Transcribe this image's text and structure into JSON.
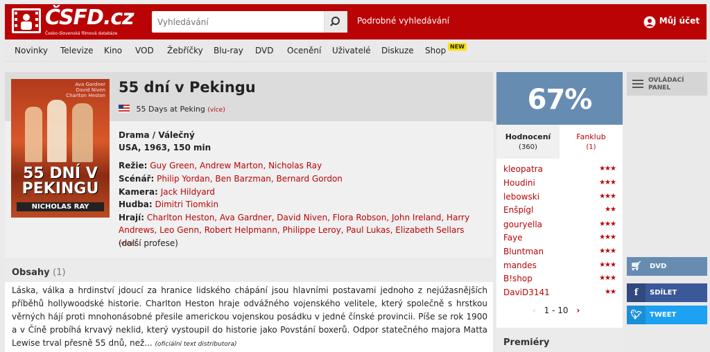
{
  "header": {
    "logo_text": "ČSFD.cz",
    "logo_sub": "Česko-Slovenská filmová databáze",
    "search_placeholder": "Vyhledávání",
    "advanced_search": "Podrobné vyhledávání",
    "account": "Můj účet"
  },
  "nav": {
    "items": [
      "Novinky",
      "Televize",
      "Kino",
      "VOD",
      "Žebříčky",
      "Blu-ray",
      "DVD",
      "Ocenění",
      "Uživatelé",
      "Diskuze",
      "Shop"
    ],
    "new_badge": "NEW"
  },
  "film": {
    "poster_title": "55 DNÍ V PEKINGU",
    "poster_names": [
      "Ava Gardner",
      "David Niven",
      "Charlton Heston"
    ],
    "poster_director": "NICHOLAS RAY",
    "title": "55 dní v Pekingu",
    "original_title": "55 Days at Peking",
    "more": "(více)",
    "genre": "Drama / Válečný",
    "origin": "USA, 1963, 150 min",
    "director_label": "Režie:",
    "directors": "Guy Green, Andrew Marton, Nicholas Ray",
    "writer_label": "Scénář:",
    "writers": "Philip Yordan, Ben Barzman, Bernard Gordon",
    "camera_label": "Kamera:",
    "camera": "Jack Hildyard",
    "music_label": "Hudba:",
    "music": "Dimitri Tiomkin",
    "cast_label": "Hrají:",
    "cast": "Charlton Heston, Ava Gardner, David Niven, Flora Robson, John Ireland, Harry Andrews, Leo Genn, Robert Helpmann, Philippe Leroy, Paul Lukas, Elizabeth Sellars",
    "cast_more": "(více)",
    "other_professions": "(další profese)"
  },
  "plot": {
    "title": "Obsahy",
    "count": "(1)",
    "text": "Láska, válka a hrdinství jdoucí za hranice lidského chápání jsou hlavními postavami jednoho z nejúžasnějších příběhů hollywoodské historie. Charlton Heston hraje odvážného vojenského velitele, který společně s hrstkou věrných hájí proti mnohonásobné přesile americkou vojenskou posádku v jedné čínské provincii. Píše se rok 1900 a v Číně probíhá krvavý neklid, který vystoupil do historie jako Povstání boxerů. Odpor statečného majora Matta Lewise trval přesně 55 dnů, než...",
    "source": "(oficiální text distributora)"
  },
  "rating": {
    "value": "67%",
    "color": "#678cb2",
    "tab_ratings": "Hodnocení",
    "tab_ratings_count": "(360)",
    "tab_fanclub": "Fanklub",
    "tab_fanclub_count": "(1)",
    "users": [
      {
        "name": "kleopatra",
        "stars": "★★★"
      },
      {
        "name": "Houdini",
        "stars": "★★★"
      },
      {
        "name": "lebowski",
        "stars": "★★★"
      },
      {
        "name": "Enšpígl",
        "stars": "★★"
      },
      {
        "name": "gouryella",
        "stars": "★★★"
      },
      {
        "name": "Faye",
        "stars": "★★★"
      },
      {
        "name": "Bluntman",
        "stars": "★★★"
      },
      {
        "name": "mandes",
        "stars": "★★★"
      },
      {
        "name": "B!shop",
        "stars": "★★★"
      },
      {
        "name": "DaviD3141",
        "stars": "★★"
      }
    ],
    "pager": "1 - 10"
  },
  "sidebar": {
    "control_panel": "OVLÁDACÍ PANEL",
    "dvd": "DVD",
    "share": "SDÍLET",
    "tweet": "TWEET",
    "premiery": "Premiéry"
  },
  "colors": {
    "brand_red": "#ba0305",
    "rating_blue": "#678cb2",
    "facebook": "#3b5998",
    "twitter": "#1da1f2"
  }
}
